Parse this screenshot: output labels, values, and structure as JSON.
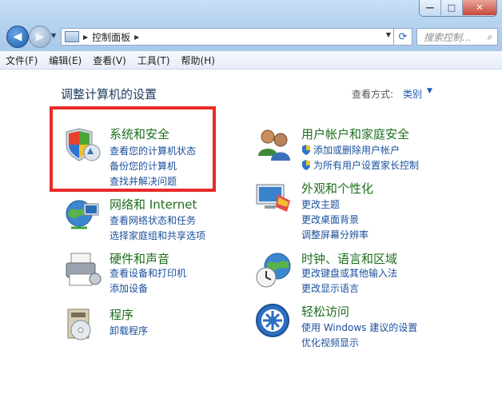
{
  "window": {
    "minimize": "—",
    "maximize": "□",
    "close": "✕"
  },
  "nav": {
    "back_icon": "arrow-left",
    "forward_icon": "arrow-right"
  },
  "address": {
    "path": "控制面板"
  },
  "search": {
    "placeholder": "搜索控制..."
  },
  "menu": [
    "文件(F)",
    "编辑(E)",
    "查看(V)",
    "工具(T)",
    "帮助(H)"
  ],
  "content": {
    "heading": "调整计算机的设置",
    "view_by_label": "查看方式:",
    "view_by_value": "类别"
  },
  "categories": [
    {
      "title": "系统和安全",
      "links": [
        "查看您的计算机状态",
        "备份您的计算机",
        "查找并解决问题"
      ]
    },
    {
      "title": "网络和 Internet",
      "links": [
        "查看网络状态和任务",
        "选择家庭组和共享选项"
      ]
    },
    {
      "title": "硬件和声音",
      "links": [
        "查看设备和打印机",
        "添加设备"
      ]
    },
    {
      "title": "程序",
      "links": [
        "卸载程序"
      ]
    },
    {
      "title": "用户帐户和家庭安全",
      "links": [
        "添加或删除用户帐户",
        "为所有用户设置家长控制"
      ]
    },
    {
      "title": "外观和个性化",
      "links": [
        "更改主题",
        "更改桌面背景",
        "调整屏幕分辨率"
      ]
    },
    {
      "title": "时钟、语言和区域",
      "links": [
        "更改键盘或其他输入法",
        "更改显示语言"
      ]
    },
    {
      "title": "轻松访问",
      "links": [
        "使用 Windows 建议的设置",
        "优化视频显示"
      ]
    }
  ],
  "colors": {
    "highlight": "#e82b2b",
    "category_title": "#1e6e1e",
    "link": "#1a4f9c"
  }
}
